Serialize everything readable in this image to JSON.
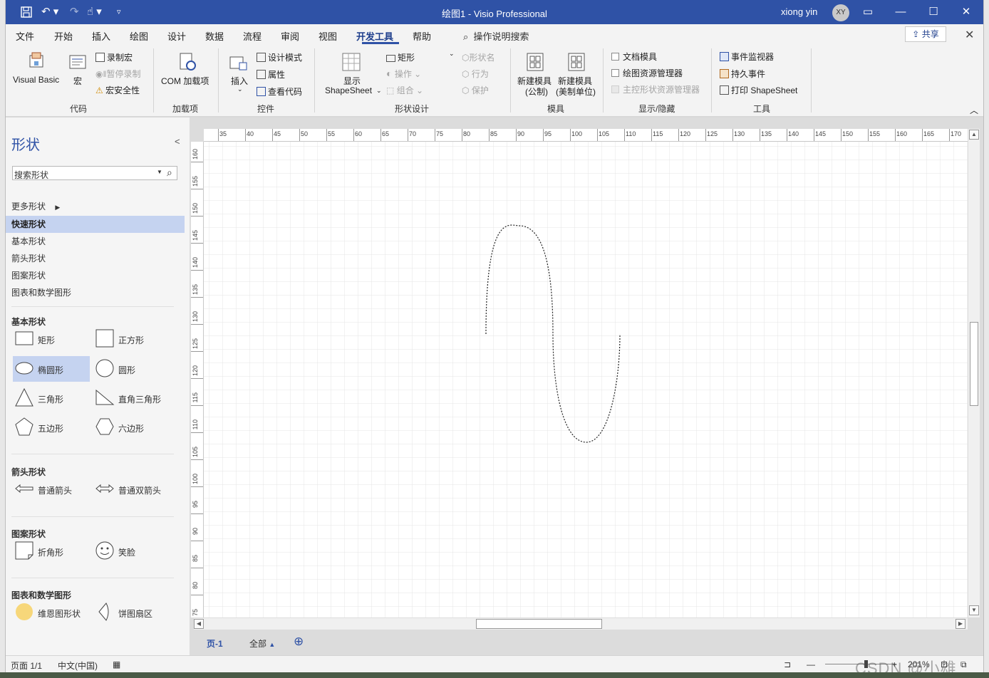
{
  "app": {
    "title": "绘图1  -  Visio Professional",
    "user_name": "xiong yin",
    "user_initials": "XY",
    "accent": "#2f52a6"
  },
  "menu": {
    "tabs": [
      "文件",
      "开始",
      "插入",
      "绘图",
      "设计",
      "数据",
      "流程",
      "审阅",
      "视图",
      "开发工具",
      "帮助"
    ],
    "active_tab": "开发工具",
    "tell_me": "操作说明搜索",
    "share": "共享"
  },
  "ribbon": {
    "code": {
      "visual_basic": "Visual Basic",
      "macros": "宏",
      "record_macro": "录制宏",
      "pause_recording": "暂停录制",
      "macro_security": "宏安全性",
      "label": "代码"
    },
    "addins": {
      "com_addins": "COM 加载项",
      "label": "加载项"
    },
    "controls": {
      "insert": "插入",
      "design_mode": "设计模式",
      "properties": "属性",
      "view_code": "查看代码",
      "label": "控件"
    },
    "shape_design": {
      "show_shapesheet_1": "显示",
      "show_shapesheet_2": "ShapeSheet",
      "rectangle": "矩形",
      "operations": "操作",
      "group": "组合",
      "shape_name": "形状名",
      "behavior": "行为",
      "protection": "保护",
      "label": "形状设计"
    },
    "stencil": {
      "new_stencil_metric_1": "新建模具",
      "new_stencil_metric_2": "(公制)",
      "new_stencil_us_1": "新建模具",
      "new_stencil_us_2": "(美制单位)",
      "label": "模具"
    },
    "show_hide": {
      "document_stencil": "文档模具",
      "drawing_explorer": "绘图资源管理器",
      "master_explorer": "主控形状资源管理器",
      "label": "显示/隐藏"
    },
    "tools": {
      "event_monitor": "事件监视器",
      "persistent_events": "持久事件",
      "print_shapesheet": "打印 ShapeSheet",
      "label": "工具"
    }
  },
  "shapes_pane": {
    "title": "形状",
    "search_placeholder": "搜索形状",
    "more_shapes": "更多形状",
    "categories": [
      "快速形状",
      "基本形状",
      "箭头形状",
      "图案形状",
      "图表和数学图形"
    ],
    "selected_category": "快速形状",
    "sections": [
      {
        "title": "基本形状",
        "items": [
          "矩形",
          "正方形",
          "椭圆形",
          "圆形",
          "三角形",
          "直角三角形",
          "五边形",
          "六边形"
        ]
      },
      {
        "title": "箭头形状",
        "items": [
          "普通箭头",
          "普通双箭头"
        ]
      },
      {
        "title": "图案形状",
        "items": [
          "折角形",
          "笑脸"
        ]
      },
      {
        "title": "图表和数学图形",
        "items": [
          "维恩图形状",
          "饼图扇区"
        ]
      }
    ],
    "selected_shape": "椭圆形"
  },
  "rulers": {
    "horizontal": [
      "35",
      "40",
      "45",
      "50",
      "55",
      "60",
      "65",
      "70",
      "75",
      "80",
      "85",
      "90",
      "95",
      "100",
      "105",
      "110",
      "115",
      "120",
      "125",
      "130",
      "135",
      "140",
      "145",
      "150",
      "155",
      "160",
      "165",
      "170"
    ],
    "vertical": [
      "160",
      "155",
      "150",
      "145",
      "140",
      "135",
      "130",
      "125",
      "120",
      "115",
      "110",
      "105",
      "100",
      "95",
      "90",
      "85",
      "80",
      "75"
    ]
  },
  "pages": {
    "current": "页-1",
    "all": "全部"
  },
  "status": {
    "page": "页面 1/1",
    "language": "中文(中国)",
    "zoom": "201%",
    "watermark": "CSDN @小雄abc"
  }
}
